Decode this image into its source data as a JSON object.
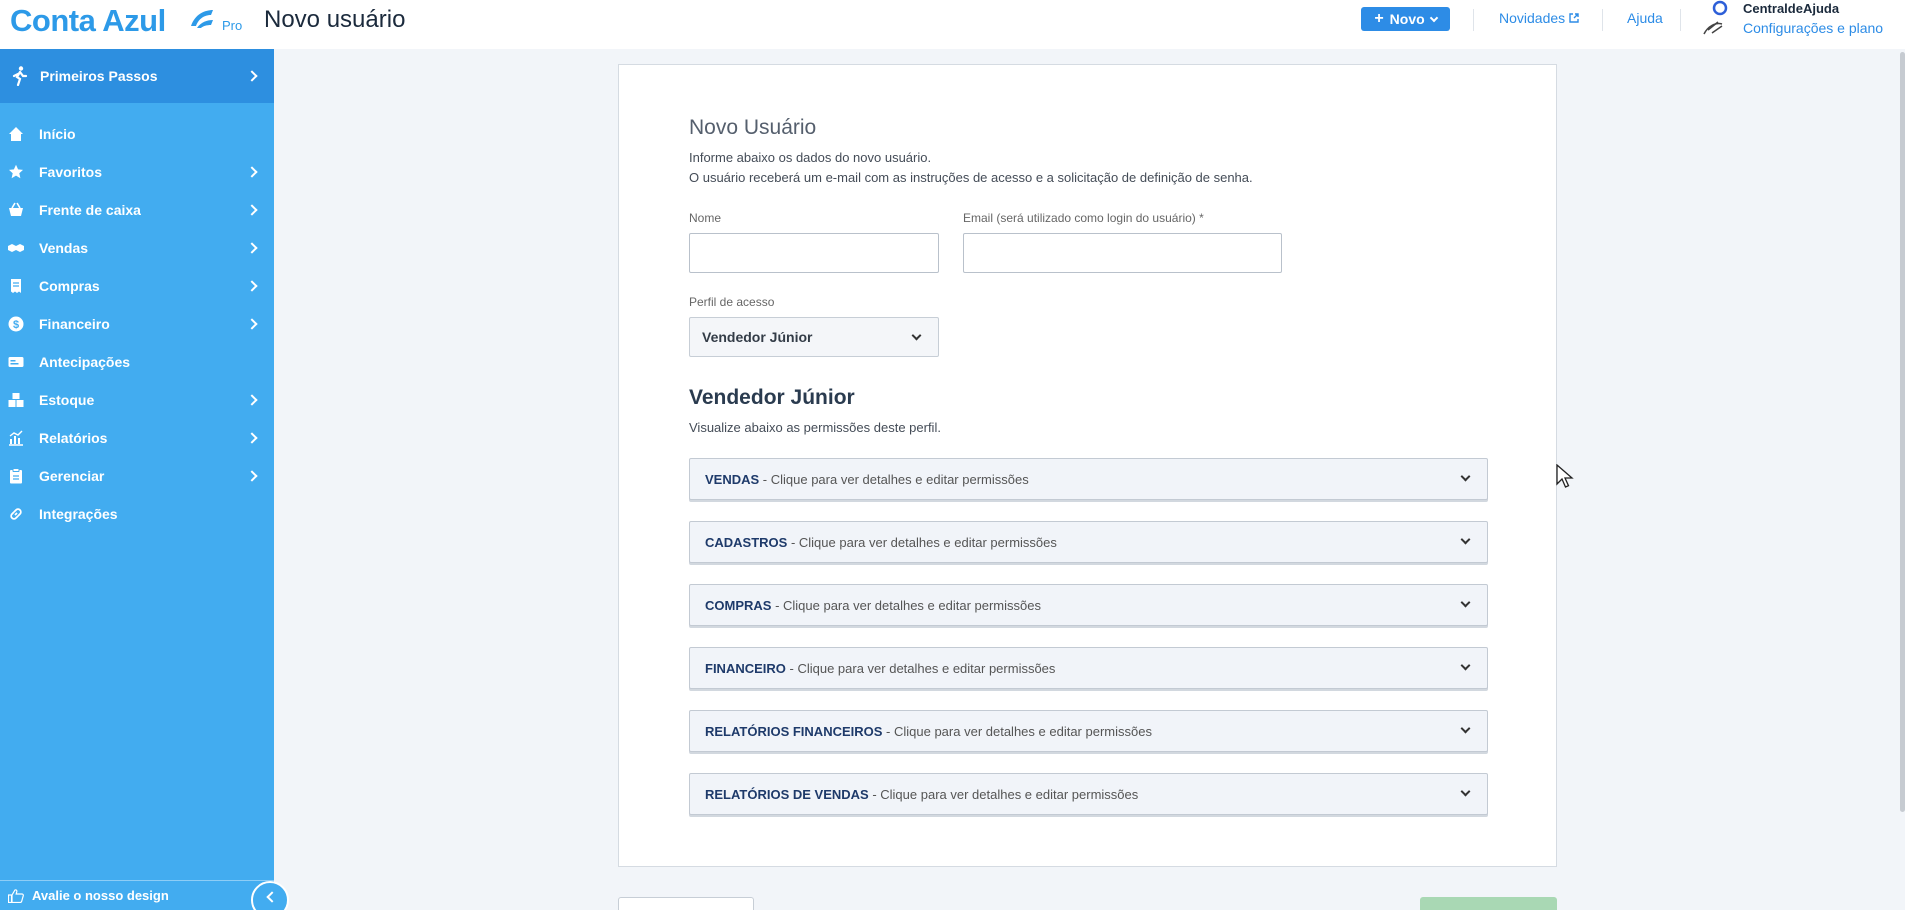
{
  "header": {
    "logo_text": "Conta Azul",
    "logo_badge": "Pro",
    "page_title": "Novo usuário",
    "new_button": "Novo",
    "news_link": "Novidades",
    "help_link": "Ajuda",
    "user_name": "CentraldeAjuda",
    "user_sub": "Configurações e plano"
  },
  "sidebar": {
    "first_steps": "Primeiros Passos",
    "items": [
      {
        "label": "Início"
      },
      {
        "label": "Favoritos"
      },
      {
        "label": "Frente de caixa"
      },
      {
        "label": "Vendas"
      },
      {
        "label": "Compras"
      },
      {
        "label": "Financeiro"
      },
      {
        "label": "Antecipações"
      },
      {
        "label": "Estoque"
      },
      {
        "label": "Relatórios"
      },
      {
        "label": "Gerenciar"
      },
      {
        "label": "Integrações"
      }
    ],
    "rate_design": "Avalie o nosso design"
  },
  "form": {
    "title": "Novo Usuário",
    "desc1": "Informe abaixo os dados do novo usuário.",
    "desc2": "O usuário receberá um e-mail com as instruções de acesso e a solicitação de definição de senha.",
    "name_label": "Nome",
    "name_value": "",
    "email_label": "Email (será utilizado como login do usuário) *",
    "email_value": "",
    "profile_label": "Perfil de acesso",
    "profile_value": "Vendedor Júnior"
  },
  "profile": {
    "title": "Vendedor Júnior",
    "desc": "Visualize abaixo as permissões deste perfil.",
    "permissions": [
      {
        "name": "VENDAS",
        "hint": " - Clique para ver detalhes e editar permissões"
      },
      {
        "name": "CADASTROS",
        "hint": " - Clique para ver detalhes e editar permissões"
      },
      {
        "name": "COMPRAS",
        "hint": " - Clique para ver detalhes e editar permissões"
      },
      {
        "name": "FINANCEIRO",
        "hint": " - Clique para ver detalhes e editar permissões"
      },
      {
        "name": "RELATÓRIOS FINANCEIROS",
        "hint": " - Clique para ver detalhes e editar permissões"
      },
      {
        "name": "RELATÓRIOS DE VENDAS",
        "hint": " - Clique para ver detalhes e editar permissões"
      }
    ]
  },
  "colors": {
    "brand": "#2d9ae8",
    "sidebar": "#42acf0",
    "sidebar_active": "#2d8fe0",
    "primary_button": "#2d8ce6",
    "permission_title": "#1e3a6a"
  }
}
